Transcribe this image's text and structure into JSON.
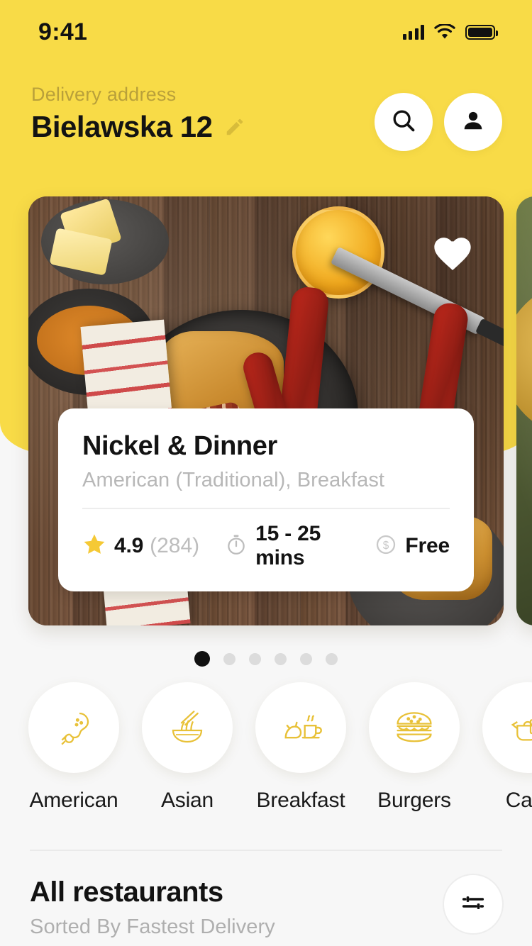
{
  "status_bar": {
    "time": "9:41",
    "signal_icon": "cellular-signal-icon",
    "wifi_icon": "wifi-icon",
    "battery_icon": "battery-full-icon"
  },
  "header": {
    "address_label": "Delivery address",
    "address_value": "Bielawska 12",
    "edit_icon": "pencil-icon",
    "search_icon": "search-icon",
    "profile_icon": "person-icon",
    "background_color": "#F8DB47"
  },
  "carousel": {
    "favorite_icon": "heart-icon",
    "cards": [
      {
        "name": "Nickel & Dinner",
        "cuisine": "American (Traditional), Breakfast",
        "rating": "4.9",
        "reviews": "(284)",
        "delivery_time": "15 - 25 mins",
        "delivery_fee": "Free",
        "rating_icon": "star-icon",
        "time_icon": "stopwatch-icon",
        "fee_icon": "dollar-circle-icon"
      }
    ],
    "pagination": {
      "total": 6,
      "active_index": 0
    }
  },
  "categories": [
    {
      "label": "American",
      "icon": "chicken-drumstick-icon"
    },
    {
      "label": "Asian",
      "icon": "noodle-bowl-icon"
    },
    {
      "label": "Breakfast",
      "icon": "croissant-coffee-icon"
    },
    {
      "label": "Burgers",
      "icon": "burger-icon"
    },
    {
      "label": "Cafe",
      "icon": "teapot-icon"
    }
  ],
  "section": {
    "title": "All restaurants",
    "subtitle": "Sorted By Fastest Delivery",
    "filter_icon": "sliders-filter-icon"
  },
  "colors": {
    "brand_yellow": "#F8DB47",
    "icon_gold": "#E8C138",
    "page_background": "#F7F7F7",
    "text_primary": "#131313",
    "text_muted": "#B7B7B7"
  }
}
